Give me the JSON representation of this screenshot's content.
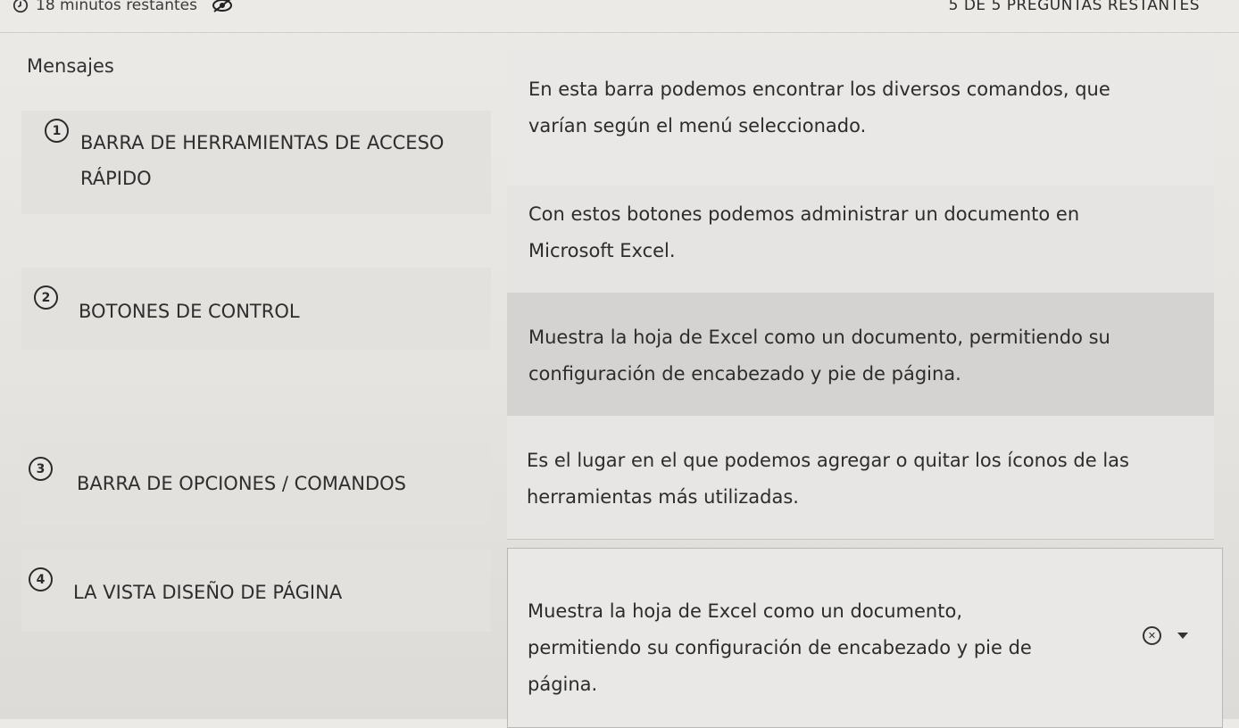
{
  "header": {
    "timer": "18 minutos restantes",
    "remaining": "5 DE 5 PREGUNTAS RESTANTES"
  },
  "left": {
    "title": "Mensajes",
    "items": [
      {
        "num": "1",
        "line1": "BARRA DE HERRAMIENTAS DE ACCESO",
        "line2": "RÁPIDO"
      },
      {
        "num": "2",
        "line1": "BOTONES DE CONTROL"
      },
      {
        "num": "3",
        "line1": "BARRA DE OPCIONES / COMANDOS"
      },
      {
        "num": "4",
        "line1": "LA VISTA DISEÑO DE PÁGINA"
      }
    ]
  },
  "options": [
    {
      "line1": "En esta barra podemos encontrar los diversos comandos, que",
      "line2": "varían según el menú seleccionado."
    },
    {
      "line1": "Con estos botones podemos administrar un documento en",
      "line2": "Microsoft Excel."
    },
    {
      "line1": "Muestra la hoja de Excel como un documento, permitiendo su",
      "line2": "configuración de encabezado y pie de página."
    },
    {
      "line1": "Es el lugar en el que podemos agregar o quitar los íconos de las",
      "line2": "herramientas más utilizadas."
    }
  ],
  "answer": {
    "line1": "Muestra la hoja de Excel como un documento,",
    "line2": "permitiendo su configuración de encabezado y pie de",
    "line3": "página."
  },
  "icons": {
    "timer": "clock-icon",
    "visibility": "eye-slash-icon",
    "clear": "close-circle-icon",
    "dropdown": "chevron-down-icon"
  }
}
